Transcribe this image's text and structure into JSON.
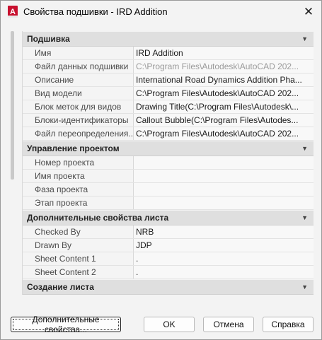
{
  "window": {
    "title": "Свойства подшивки - IRD Addition",
    "app_icon": "A",
    "close_glyph": "✕"
  },
  "sections": [
    {
      "title": "Подшивка",
      "rows": [
        {
          "name": "Имя",
          "value": "IRD Addition",
          "disabled": false
        },
        {
          "name": "Файл данных подшивки",
          "value": "C:\\Program Files\\Autodesk\\AutoCAD 202...",
          "disabled": true
        },
        {
          "name": "Описание",
          "value": "International Road Dynamics Addition Pha...",
          "disabled": false
        },
        {
          "name": "Вид модели",
          "value": "C:\\Program Files\\Autodesk\\AutoCAD 202...",
          "disabled": false
        },
        {
          "name": "Блок меток для видов",
          "value": "Drawing Title(C:\\Program Files\\Autodesk\\...",
          "disabled": false
        },
        {
          "name": "Блоки-идентификаторы",
          "value": "Callout Bubble(C:\\Program Files\\Autodes...",
          "disabled": false
        },
        {
          "name": "Файл  переопределения...",
          "value": "C:\\Program Files\\Autodesk\\AutoCAD 202...",
          "disabled": false
        }
      ]
    },
    {
      "title": "Управление проектом",
      "rows": [
        {
          "name": "Номер проекта",
          "value": "",
          "disabled": false
        },
        {
          "name": "Имя проекта",
          "value": "",
          "disabled": false
        },
        {
          "name": "Фаза проекта",
          "value": "",
          "disabled": false
        },
        {
          "name": "Этап проекта",
          "value": "",
          "disabled": false
        }
      ]
    },
    {
      "title": "Дополнительные свойства листа",
      "rows": [
        {
          "name": "Checked By",
          "value": "NRB",
          "disabled": false
        },
        {
          "name": "Drawn By",
          "value": "JDP",
          "disabled": false
        },
        {
          "name": "Sheet Content 1",
          "value": ".",
          "disabled": false
        },
        {
          "name": "Sheet Content 2",
          "value": ".",
          "disabled": false
        }
      ]
    },
    {
      "title": "Создание листа",
      "rows": []
    }
  ],
  "buttons": {
    "more": "Дополнительные свойства...",
    "ok": "OK",
    "cancel": "Отмена",
    "help": "Справка"
  },
  "colors": {
    "accent_icon": "#c8102e"
  },
  "icons": {
    "collapse": "chevron-down-icon"
  }
}
